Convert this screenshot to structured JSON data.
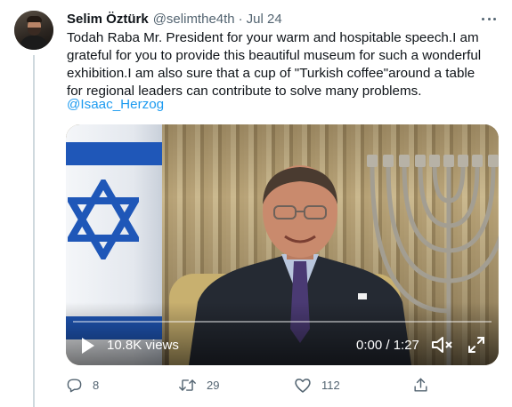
{
  "tweet": {
    "display_name": "Selim Öztürk",
    "handle": "@selimthe4th",
    "separator": "·",
    "date": "Jul 24",
    "text_lines": [
      "Todah Raba Mr. President for your warm and hospitable speech.I am",
      "grateful for you to provide this beautiful museum for such a wonderful",
      "exhibition.I am also sure that a cup of \"Turkish coffee\"around a table",
      "for regional leaders can contribute to solve many problems."
    ],
    "mention": "@Isaac_Herzog"
  },
  "video": {
    "views": "10.8K views",
    "time": "0:00 / 1:27",
    "progress_fraction": 0.0
  },
  "actions": {
    "replies": "8",
    "retweets": "29",
    "likes": "112"
  },
  "icons": [
    "more-icon",
    "play-icon",
    "volume-icon",
    "expand-icon",
    "reply-icon",
    "retweet-icon",
    "like-icon",
    "share-icon"
  ],
  "colors": {
    "accent": "#1d9bf0",
    "secondary_text": "#536471",
    "primary_text": "#0f1419",
    "thread_line": "#cfd9de"
  }
}
